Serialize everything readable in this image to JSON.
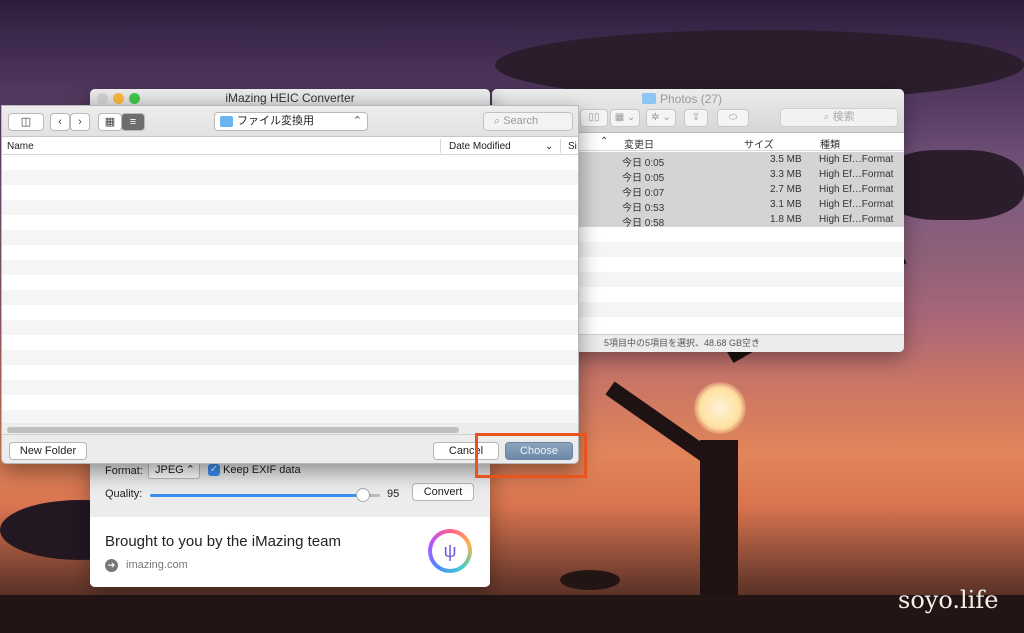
{
  "finder": {
    "title": "Photos (27)",
    "search_placeholder": "検索",
    "headers": {
      "date": "変更日",
      "size": "サイズ",
      "kind": "種類"
    },
    "rows": [
      {
        "date": "今日 0:05",
        "size": "3.5 MB",
        "kind": "High Ef…Format"
      },
      {
        "date": "今日 0:05",
        "size": "3.3 MB",
        "kind": "High Ef…Format"
      },
      {
        "date": "今日 0:07",
        "size": "2.7 MB",
        "kind": "High Ef…Format"
      },
      {
        "date": "今日 0:53",
        "size": "3.1 MB",
        "kind": "High Ef…Format"
      },
      {
        "date": "今日 0:58",
        "size": "1.8 MB",
        "kind": "High Ef…Format"
      }
    ],
    "status": "5項目中の5項目を選択、48.68 GB空き"
  },
  "imazing": {
    "title": "iMazing HEIC Converter",
    "format_label": "Format:",
    "format_value": "JPEG",
    "exif_label": "Keep EXIF data",
    "quality_label": "Quality:",
    "quality_value": "95",
    "convert_label": "Convert",
    "promo_text": "Brought to you by the iMazing team",
    "link_text": "imazing.com"
  },
  "sheet": {
    "location": "ファイル変換用",
    "search_placeholder": "Search",
    "col_name": "Name",
    "col_date": "Date Modified",
    "col_size": "Si",
    "new_folder_label": "New Folder",
    "cancel_label": "Cancel",
    "choose_label": "Choose"
  },
  "watermark": "soyo.life",
  "colors": {
    "accent": "#3b8ff3",
    "highlight": "#e8541e",
    "choose_button": "#7d97b4"
  }
}
